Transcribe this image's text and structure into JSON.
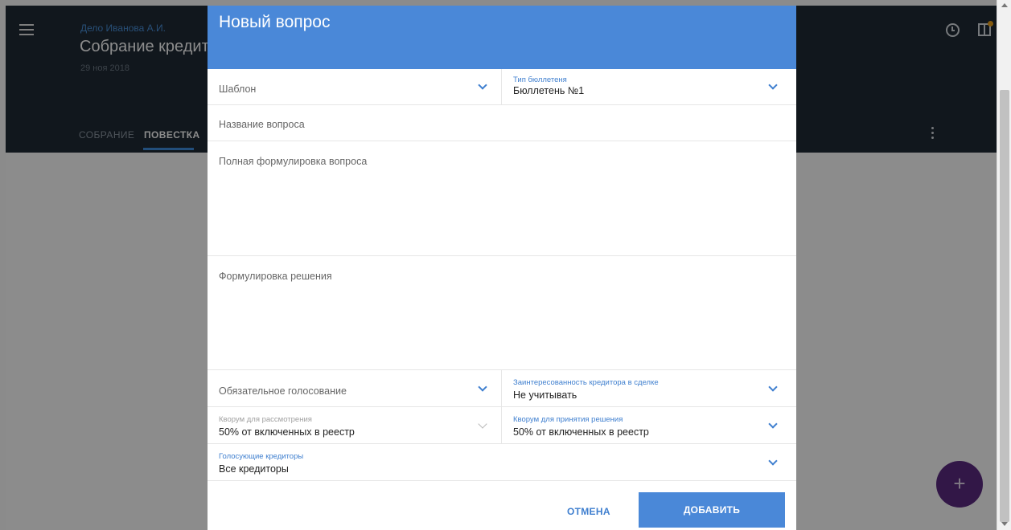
{
  "appbar": {
    "case_name": "Дело Иванова А.И.",
    "meeting_title": "Собрание кредиторов",
    "meeting_date": "29 ноя 2018",
    "tabs": [
      {
        "label": "СОБРАНИЕ"
      },
      {
        "label": "ПОВЕСТКА"
      }
    ]
  },
  "dialog": {
    "title": "Новый вопрос",
    "template_field": {
      "placeholder": "Шаблон"
    },
    "ballot_type": {
      "label": "Тип бюллетеня",
      "value": "Бюллетень №1"
    },
    "question_name": {
      "placeholder": "Название вопроса"
    },
    "question_full": {
      "placeholder": "Полная формулировка вопроса"
    },
    "decision_wording": {
      "placeholder": "Формулировка решения"
    },
    "mandatory_voting": {
      "placeholder": "Обязательное голосование"
    },
    "creditor_interest": {
      "label": "Заинтересованность кредитора в сделке",
      "value": "Не учитывать"
    },
    "quorum_review": {
      "label": "Кворум для рассмотрения",
      "value": "50% от включенных в реестр"
    },
    "quorum_decision": {
      "label": "Кворум для принятия решения",
      "value": "50% от включенных в реестр"
    },
    "voting_creditors": {
      "label": "Голосующие кредиторы",
      "value": "Все кредиторы"
    },
    "cancel_label": "ОТМЕНА",
    "add_label": "ДОБАВИТЬ"
  },
  "fab": {
    "label": "+"
  },
  "colors": {
    "accent": "#4a88d8",
    "appbar": "#1f2a36",
    "fab": "#5b2a82"
  }
}
